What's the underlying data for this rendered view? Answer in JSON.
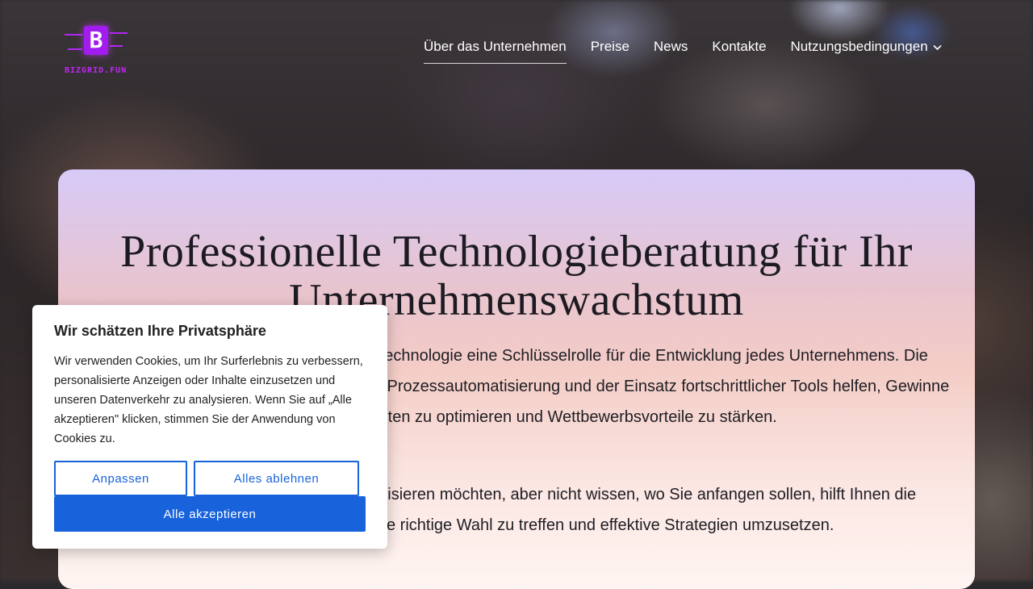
{
  "brand": {
    "logo_letter": "B",
    "logo_text": "BIZGRID.FUN",
    "accent": "#a21cf0"
  },
  "nav": {
    "items": [
      {
        "label": "Über das Unternehmen",
        "active": true
      },
      {
        "label": "Preise"
      },
      {
        "label": "News"
      },
      {
        "label": "Kontakte"
      },
      {
        "label": "Nutzungsbedingungen",
        "dropdown": true
      }
    ],
    "dropdown_icon": "chevron-down-icon"
  },
  "hero": {
    "title": "Professionelle Technologieberatung für Ihr Unternehmenswachstum",
    "paragraph1": "In der heutigen digitalen Welt spielt Technologie eine Schlüsselrolle für die Entwicklung jedes Unternehmens. Die Implementierung innovativer Lösungen, Prozessautomatisierung und der Einsatz fortschrittlicher Tools helfen, Gewinne zu steigern, Kosten zu optimieren und Wettbewerbsvorteile zu stärken.",
    "paragraph2": "Wenn Sie Ihr Unternehmen modernisieren möchten, aber nicht wissen, wo Sie anfangen sollen, hilft Ihnen die Technologieberatung, die richtige Wahl zu treffen und effektive Strategien umzusetzen."
  },
  "cookie_banner": {
    "title": "Wir schätzen Ihre Privatsphäre",
    "text": "Wir verwenden Cookies, um Ihr Surferlebnis zu verbessern, personalisierte Anzeigen oder Inhalte einzusetzen und unseren Datenverkehr zu analysieren. Wenn Sie auf „Alle akzeptieren\" klicken, stimmen Sie der Anwendung von Cookies zu.",
    "customize_label": "Anpassen",
    "reject_label": "Alles ablehnen",
    "accept_label": "Alle akzeptieren",
    "primary_color": "#1863dc"
  }
}
